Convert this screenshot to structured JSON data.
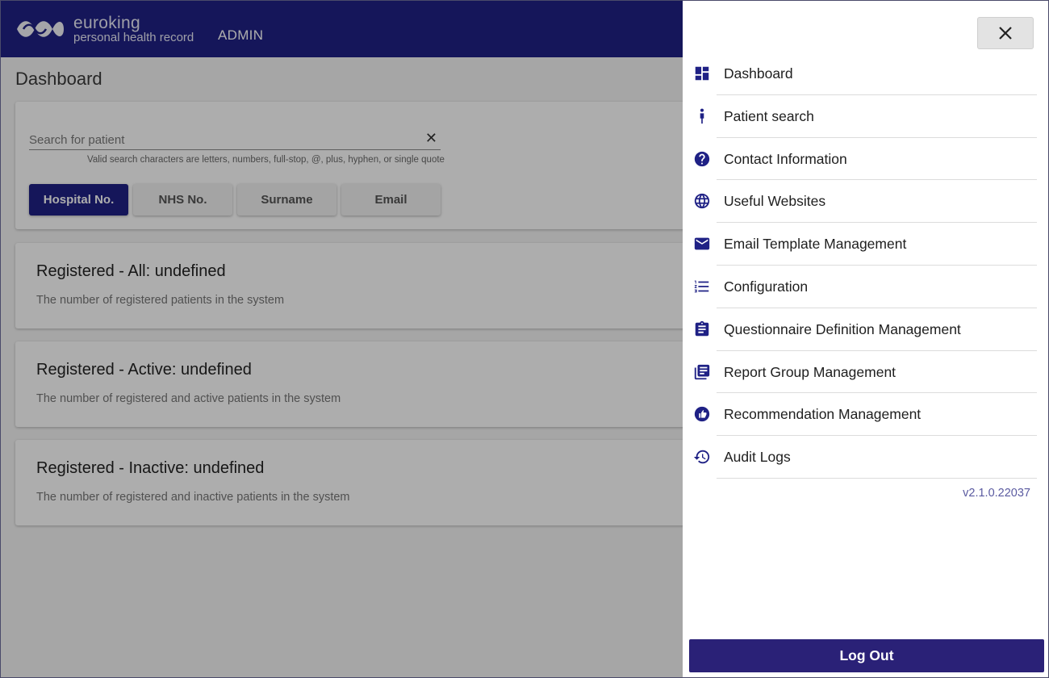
{
  "header": {
    "logo_line1": "euroking",
    "logo_line2": "personal health record",
    "role": "ADMIN"
  },
  "page": {
    "title": "Dashboard"
  },
  "search": {
    "placeholder": "Search for patient",
    "clear_icon": "close-icon",
    "hint": "Valid search characters are letters, numbers, full-stop, @, plus, hyphen, or single quote",
    "buttons": [
      {
        "label": "Hospital No.",
        "active": true
      },
      {
        "label": "NHS No.",
        "active": false
      },
      {
        "label": "Surname",
        "active": false
      },
      {
        "label": "Email",
        "active": false
      }
    ]
  },
  "stats": [
    {
      "title": "Registered - All: undefined",
      "description": "The number of registered patients in the system"
    },
    {
      "title": "Registered - Active: undefined",
      "description": "The number of registered and active patients in the system"
    },
    {
      "title": "Registered - Inactive: undefined",
      "description": "The number of registered and inactive patients in the system"
    }
  ],
  "drawer": {
    "close_icon": "close-icon",
    "items": [
      {
        "label": "Dashboard",
        "icon": "dashboard-icon"
      },
      {
        "label": "Patient search",
        "icon": "person-icon"
      },
      {
        "label": "Contact Information",
        "icon": "help-icon"
      },
      {
        "label": "Useful Websites",
        "icon": "globe-icon"
      },
      {
        "label": "Email Template Management",
        "icon": "mail-icon"
      },
      {
        "label": "Configuration",
        "icon": "numbered-list-icon"
      },
      {
        "label": "Questionnaire Definition Management",
        "icon": "clipboard-icon"
      },
      {
        "label": "Report Group Management",
        "icon": "library-icon"
      },
      {
        "label": "Recommendation Management",
        "icon": "thumb-up-icon"
      },
      {
        "label": "Audit Logs",
        "icon": "history-icon"
      }
    ],
    "version": "v2.1.0.22037",
    "logout_label": "Log Out"
  },
  "colors": {
    "brand": "#1f2185",
    "logout": "#2a2177",
    "version_text": "#5a5aa0"
  }
}
